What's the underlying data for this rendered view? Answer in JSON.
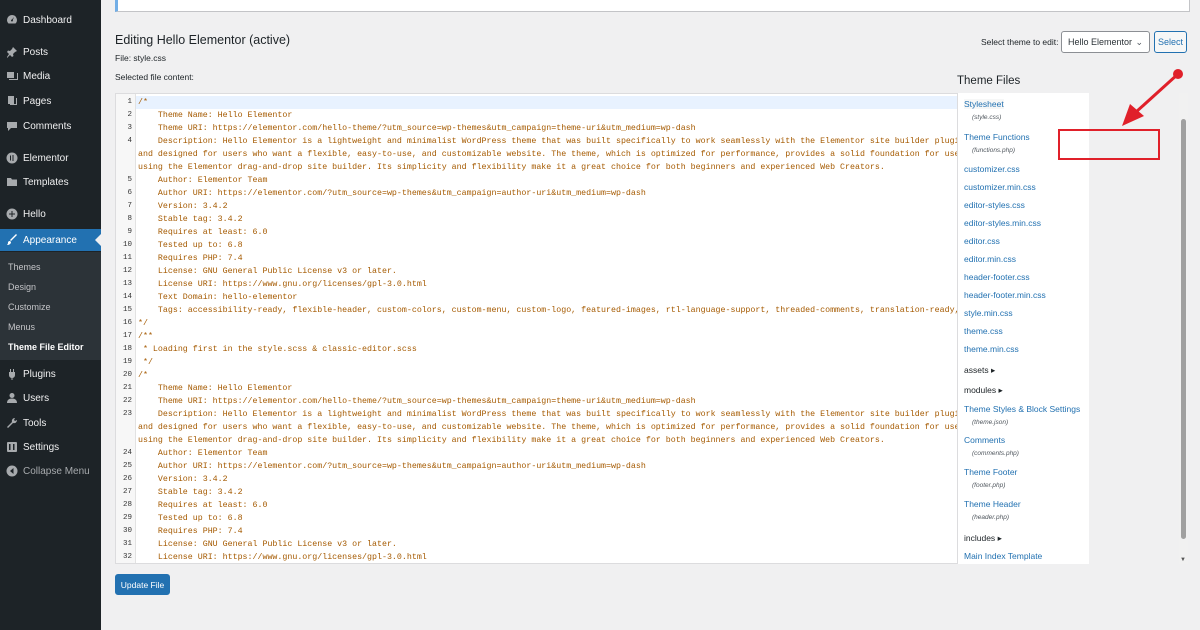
{
  "sidebar": {
    "items": [
      {
        "label": "Dashboard",
        "icon": "dashboard-icon"
      },
      {
        "label": "Posts",
        "icon": "pin-icon"
      },
      {
        "label": "Media",
        "icon": "media-icon"
      },
      {
        "label": "Pages",
        "icon": "pages-icon"
      },
      {
        "label": "Comments",
        "icon": "comments-icon"
      },
      {
        "label": "Elementor",
        "icon": "elementor-icon"
      },
      {
        "label": "Templates",
        "icon": "folder-icon"
      },
      {
        "label": "Hello",
        "icon": "hello-icon"
      },
      {
        "label": "Appearance",
        "icon": "brush-icon"
      },
      {
        "label": "Plugins",
        "icon": "plugin-icon"
      },
      {
        "label": "Users",
        "icon": "user-icon"
      },
      {
        "label": "Tools",
        "icon": "wrench-icon"
      },
      {
        "label": "Settings",
        "icon": "settings-icon"
      },
      {
        "label": "Collapse Menu",
        "icon": "collapse-icon"
      }
    ],
    "submenu": [
      "Themes",
      "Design",
      "Customize",
      "Menus",
      "Theme File Editor"
    ],
    "active_item": "Appearance",
    "current_submenu": "Theme File Editor"
  },
  "header": {
    "title": "Editing Hello Elementor (active)",
    "file": "File: style.css",
    "selected_label": "Selected file content:",
    "theme_select_label": "Select theme to edit:",
    "theme_select_value": "Hello Elementor",
    "select_button": "Select"
  },
  "editor": {
    "lines": [
      {
        "n": "1",
        "t": "/*"
      },
      {
        "n": "2",
        "t": "    Theme Name: Hello Elementor"
      },
      {
        "n": "3",
        "t": "    Theme URI: https://elementor.com/hello-theme/?utm_source=wp-themes&utm_campaign=theme-uri&utm_medium=wp-dash"
      },
      {
        "n": "4",
        "t": "    Description: Hello Elementor is a lightweight and minimalist WordPress theme that was built specifically to work seamlessly with the Elementor site builder plugin. The theme is free, open-source,"
      },
      {
        "n": "",
        "t": "and designed for users who want a flexible, easy-to-use, and customizable website. The theme, which is optimized for performance, provides a solid foundation for users to build their own unique designs"
      },
      {
        "n": "",
        "t": "using the Elementor drag-and-drop site builder. Its simplicity and flexibility make it a great choice for both beginners and experienced Web Creators."
      },
      {
        "n": "5",
        "t": "    Author: Elementor Team"
      },
      {
        "n": "6",
        "t": "    Author URI: https://elementor.com/?utm_source=wp-themes&utm_campaign=author-uri&utm_medium=wp-dash"
      },
      {
        "n": "7",
        "t": "    Version: 3.4.2"
      },
      {
        "n": "8",
        "t": "    Stable tag: 3.4.2"
      },
      {
        "n": "9",
        "t": "    Requires at least: 6.0"
      },
      {
        "n": "10",
        "t": "    Tested up to: 6.8"
      },
      {
        "n": "11",
        "t": "    Requires PHP: 7.4"
      },
      {
        "n": "12",
        "t": "    License: GNU General Public License v3 or later."
      },
      {
        "n": "13",
        "t": "    License URI: https://www.gnu.org/licenses/gpl-3.0.html"
      },
      {
        "n": "14",
        "t": "    Text Domain: hello-elementor"
      },
      {
        "n": "15",
        "t": "    Tags: accessibility-ready, flexible-header, custom-colors, custom-menu, custom-logo, featured-images, rtl-language-support, threaded-comments, translation-ready,"
      },
      {
        "n": "16",
        "t": "*/"
      },
      {
        "n": "17",
        "t": "/**"
      },
      {
        "n": "18",
        "t": " * Loading first in the style.scss & classic-editor.scss"
      },
      {
        "n": "19",
        "t": " */"
      },
      {
        "n": "20",
        "t": "/*"
      },
      {
        "n": "21",
        "t": "    Theme Name: Hello Elementor"
      },
      {
        "n": "22",
        "t": "    Theme URI: https://elementor.com/hello-theme/?utm_source=wp-themes&utm_campaign=theme-uri&utm_medium=wp-dash"
      },
      {
        "n": "23",
        "t": "    Description: Hello Elementor is a lightweight and minimalist WordPress theme that was built specifically to work seamlessly with the Elementor site builder plugin. The theme is free, open-source,"
      },
      {
        "n": "",
        "t": "and designed for users who want a flexible, easy-to-use, and customizable website. The theme, which is optimized for performance, provides a solid foundation for users to build their own unique designs"
      },
      {
        "n": "",
        "t": "using the Elementor drag-and-drop site builder. Its simplicity and flexibility make it a great choice for both beginners and experienced Web Creators."
      },
      {
        "n": "24",
        "t": "    Author: Elementor Team"
      },
      {
        "n": "25",
        "t": "    Author URI: https://elementor.com/?utm_source=wp-themes&utm_campaign=author-uri&utm_medium=wp-dash"
      },
      {
        "n": "26",
        "t": "    Version: 3.4.2"
      },
      {
        "n": "27",
        "t": "    Stable tag: 3.4.2"
      },
      {
        "n": "28",
        "t": "    Requires at least: 6.0"
      },
      {
        "n": "29",
        "t": "    Tested up to: 6.8"
      },
      {
        "n": "30",
        "t": "    Requires PHP: 7.4"
      },
      {
        "n": "31",
        "t": "    License: GNU General Public License v3 or later."
      },
      {
        "n": "32",
        "t": "    License URI: https://www.gnu.org/licenses/gpl-3.0.html"
      }
    ]
  },
  "update_button": "Update File",
  "files": {
    "title": "Theme Files",
    "items": [
      {
        "label": "Stylesheet",
        "sub": "(style.css)",
        "current": true
      },
      {
        "label": "Theme Functions",
        "sub": "(functions.php)"
      },
      {
        "label": "customizer.css"
      },
      {
        "label": "customizer.min.css"
      },
      {
        "label": "editor-styles.css"
      },
      {
        "label": "editor-styles.min.css"
      },
      {
        "label": "editor.css"
      },
      {
        "label": "editor.min.css"
      },
      {
        "label": "header-footer.css"
      },
      {
        "label": "header-footer.min.css"
      },
      {
        "label": "style.min.css"
      },
      {
        "label": "theme.css"
      },
      {
        "label": "theme.min.css"
      },
      {
        "label": "assets",
        "folder": true
      },
      {
        "label": "modules",
        "folder": true
      },
      {
        "label": "Theme Styles & Block Settings",
        "sub": "(theme.json)"
      },
      {
        "label": "Comments",
        "sub": "(comments.php)"
      },
      {
        "label": "Theme Footer",
        "sub": "(footer.php)"
      },
      {
        "label": "Theme Header",
        "sub": "(header.php)"
      },
      {
        "label": "includes",
        "folder": true
      },
      {
        "label": "Main Index Template"
      }
    ]
  },
  "colors": {
    "sidebar_bg": "#1d2327",
    "accent": "#2271b1",
    "code_text": "#a55a00",
    "annotation": "#e0202a"
  }
}
